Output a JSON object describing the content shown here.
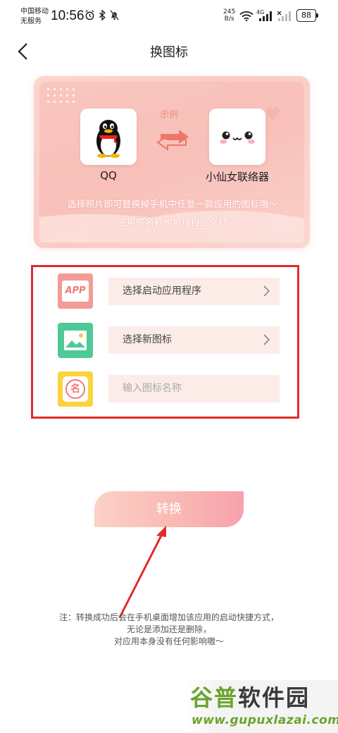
{
  "status_bar": {
    "carrier_line1": "中国移动",
    "carrier_line2": "无服务",
    "time": "10:56",
    "net_speed": "245",
    "net_unit": "B/s",
    "network_type": "4G",
    "battery": "88"
  },
  "header": {
    "title": "换图标"
  },
  "banner": {
    "example_label": "示例",
    "source_app": "QQ",
    "target_app": "小仙女联络器",
    "desc_line1": "选择照片即可替换掉手机中任意一款应用的图标哦～",
    "desc_line2": "应用的名称也可以自定义哒"
  },
  "options": {
    "app_icon_text": "APP",
    "select_app_label": "选择启动应用程序",
    "select_icon_label": "选择新图标",
    "name_icon_text": "名",
    "name_placeholder": "输入图标名称"
  },
  "convert_button": {
    "label": "转换"
  },
  "note": {
    "line1": "注：转换成功后会在手机桌面增加该应用的启动快捷方式，",
    "line2": "无论是添加还是删除，",
    "line3": "对应用本身没有任何影响嗷～"
  },
  "watermark": {
    "title_part1": "谷普",
    "title_part2": "软件园",
    "url": "www.gupuxlazai.com"
  },
  "colors": {
    "accent_pink": "#f7a1ad",
    "highlight_red": "#e02b2b",
    "field_bg": "#fcece8"
  }
}
